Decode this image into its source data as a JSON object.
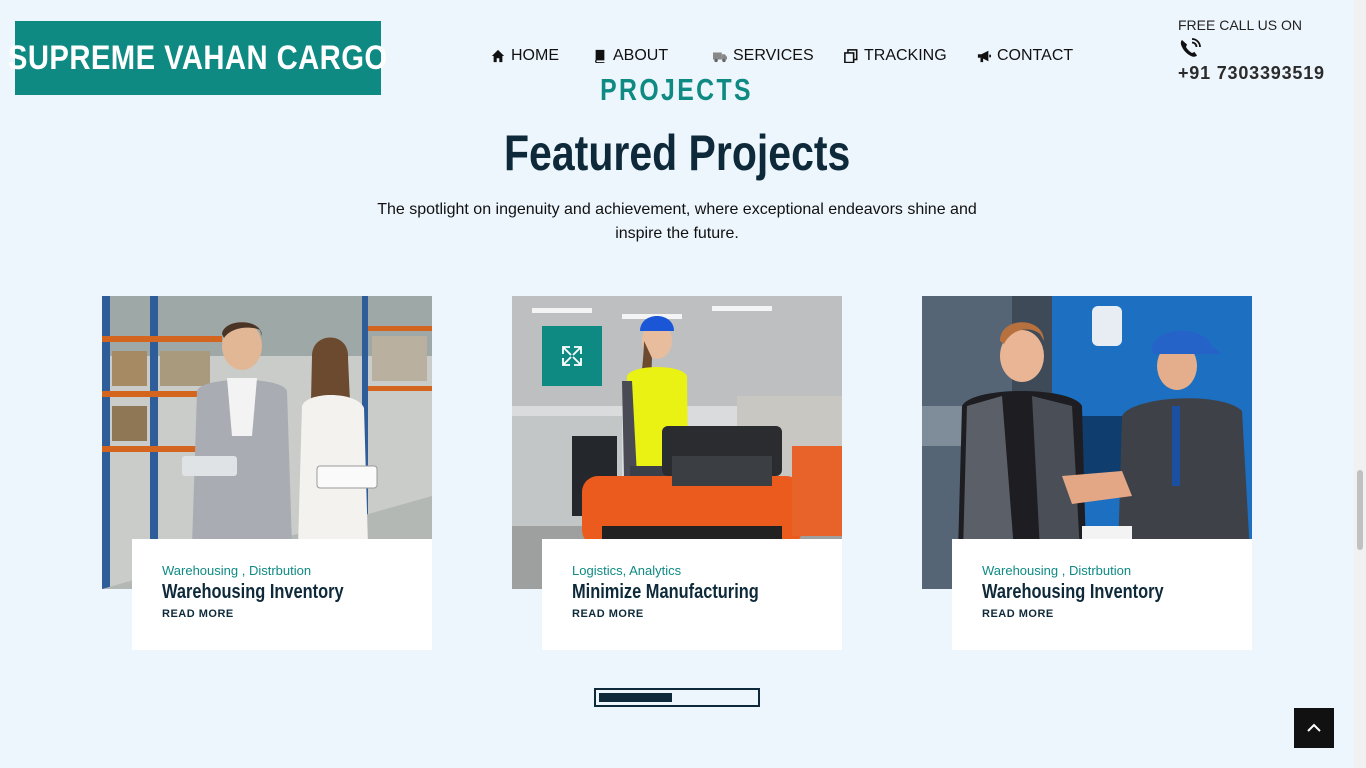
{
  "brand": {
    "name": "SUPREME VAHAN CARGO",
    "color": "#0e8a83"
  },
  "nav": [
    {
      "label": "HOME",
      "icon": "home-icon"
    },
    {
      "label": "ABOUT",
      "icon": "book-icon"
    },
    {
      "label": "SERVICES",
      "icon": "truck-icon"
    },
    {
      "label": "TRACKING",
      "icon": "copy-icon"
    },
    {
      "label": "CONTACT",
      "icon": "megaphone-icon"
    }
  ],
  "call": {
    "label": "FREE CALL US ON",
    "icon": "phone-icon",
    "number": "+91 7303393519"
  },
  "section": {
    "eyebrow": "PROJECTS",
    "title": "Featured Projects",
    "subtitle": "The spotlight on ingenuity and achievement, where exceptional endeavors shine and inspire the future."
  },
  "projects": [
    {
      "categories": "Warehousing , Distrbution",
      "title": "Warehousing Inventory",
      "read_more": "READ MORE",
      "image": "warehouse-managers-photo"
    },
    {
      "categories": "Logistics, Analytics",
      "title": "Minimize Manufacturing",
      "read_more": "READ MORE",
      "image": "forklift-worker-photo",
      "overlay_icon": "expand-icon"
    },
    {
      "categories": "Warehousing , Distrbution",
      "title": "Warehousing Inventory",
      "read_more": "READ MORE",
      "image": "truck-handshake-photo"
    }
  ],
  "carousel": {
    "progress": 0.47
  },
  "back_to_top": {
    "icon": "chevron-up-icon"
  }
}
